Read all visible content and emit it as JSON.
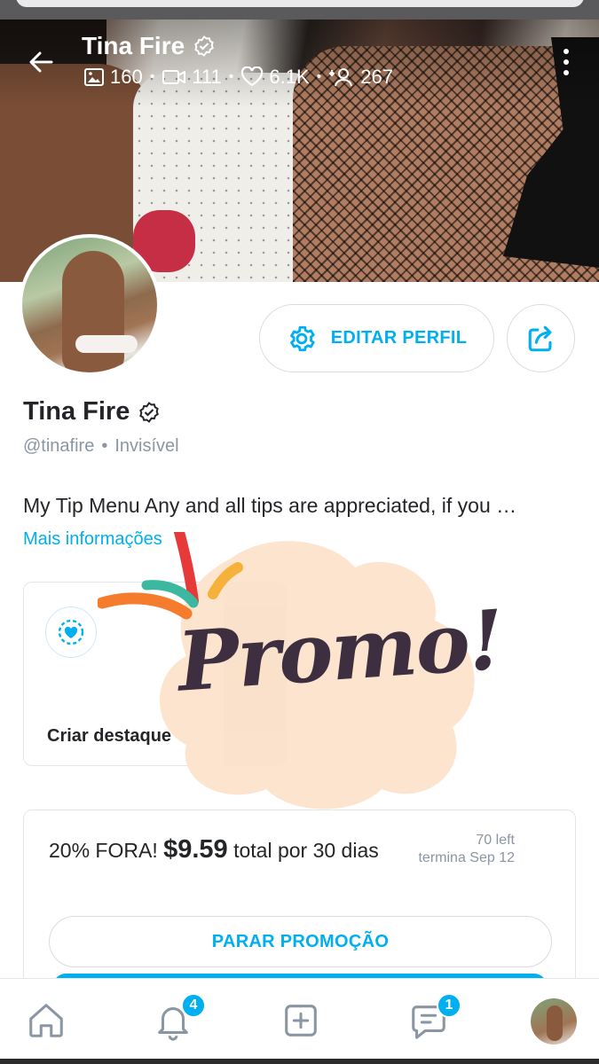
{
  "profile": {
    "name": "Tina Fire",
    "handle": "@tinafire",
    "status": "Invisível",
    "bio": "My Tip Menu Any and all tips are appreciated, if you …",
    "more_info": "Mais informações"
  },
  "stats": {
    "photos": "160",
    "videos": "111",
    "likes": "6.1K",
    "fans": "267"
  },
  "actions": {
    "edit_profile": "EDITAR PERFIL"
  },
  "highlight": {
    "label": "Criar destaque"
  },
  "overlay": {
    "promo_text": "Promo!"
  },
  "promotion": {
    "discount": "20% FORA!",
    "price": "$9.59",
    "duration": "total por 30 dias",
    "left": "70 left",
    "ends": "termina Sep 12",
    "stop_button": "PARAR PROMOÇÃO"
  },
  "nav": {
    "notifications_badge": "4",
    "messages_badge": "1",
    "items": [
      "home-icon",
      "bell-icon",
      "add-post-icon",
      "chat-icon",
      "avatar"
    ]
  },
  "colors": {
    "accent": "#00aff0",
    "text": "#242529",
    "muted": "#8a96a3"
  }
}
